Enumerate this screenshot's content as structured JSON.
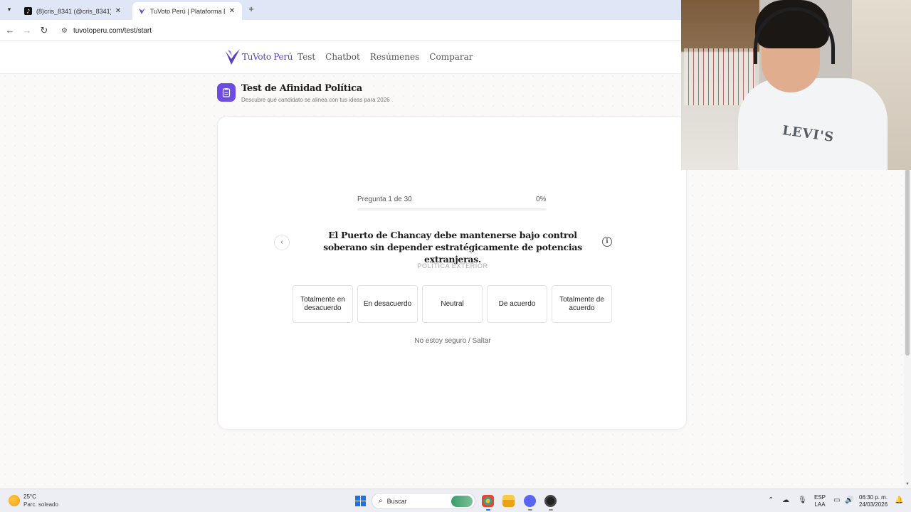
{
  "browser": {
    "tabs": [
      {
        "title": "(8)cris_8341 (@cris_8341) | TikTo",
        "active": false
      },
      {
        "title": "TuVoto Perú | Plataforma Electo",
        "active": true
      }
    ],
    "url": "tuvotoperu.com/test/start"
  },
  "site": {
    "logo_text": "TuVoto Perú",
    "nav": [
      "Test",
      "Chatbot",
      "Resúmenes",
      "Comparar"
    ]
  },
  "test": {
    "title": "Test de Afinidad Política",
    "subtitle": "Descubre qué candidato se alinea con tus ideas para 2026"
  },
  "question": {
    "progress_label": "Pregunta 1 de 30",
    "progress_percent_label": "0%",
    "progress_fraction": 0,
    "text": "El Puerto de Chancay debe mantenerse bajo control soberano sin depender estratégicamente de potencias extranjeras.",
    "category": "POLÍTICA EXTERIOR",
    "options": [
      "Totalmente en desacuerdo",
      "En desacuerdo",
      "Neutral",
      "De acuerdo",
      "Totalmente de acuerdo"
    ],
    "skip": "No estoy seguro / Saltar"
  },
  "webcam": {
    "shirt_logo": "LEVI'S"
  },
  "taskbar": {
    "weather_temp": "25°C",
    "weather_desc": "Parc. soleado",
    "search_placeholder": "Buscar",
    "lang_line1": "ESP",
    "lang_line2": "LAA",
    "time": "06:30 p. m.",
    "date": "24/03/2026",
    "accent": "#1a73e8"
  },
  "colors": {
    "brand_purple": "#6d4de0"
  }
}
